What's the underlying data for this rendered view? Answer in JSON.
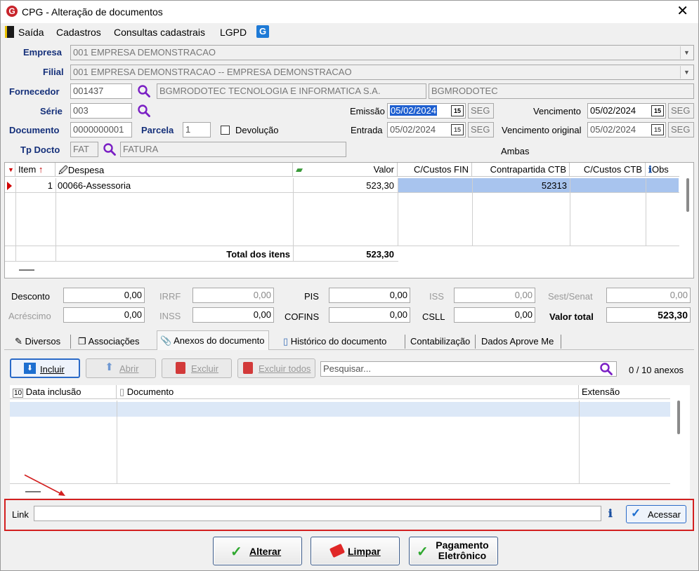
{
  "window": {
    "title": "CPG - Alteração de documentos"
  },
  "menu": {
    "items": [
      "Saída",
      "Cadastros",
      "Consultas cadastrais",
      "LGPD"
    ]
  },
  "form": {
    "empresa": {
      "label": "Empresa",
      "value": "001 EMPRESA DEMONSTRACAO"
    },
    "filial": {
      "label": "Filial",
      "value": "001 EMPRESA DEMONSTRACAO -- EMPRESA DEMONSTRACAO"
    },
    "fornecedor": {
      "label": "Fornecedor",
      "code": "001437",
      "name": "BGMRODOTEC TECNOLOGIA E INFORMATICA S.A.",
      "short": "BGMRODOTEC"
    },
    "serie": {
      "label": "Série",
      "value": "003"
    },
    "documento": {
      "label": "Documento",
      "value": "0000000001"
    },
    "parcela": {
      "label": "Parcela",
      "value": "1"
    },
    "devolucao": {
      "label": "Devolução",
      "checked": false
    },
    "tp_docto": {
      "label": "Tp Docto",
      "code": "FAT",
      "name": "FATURA"
    },
    "emissao": {
      "label": "Emissão",
      "date": "05/02/2024",
      "day": "SEG"
    },
    "entrada": {
      "label": "Entrada",
      "date": "05/02/2024",
      "day": "SEG"
    },
    "vencimento": {
      "label": "Vencimento",
      "date": "05/02/2024",
      "day": "SEG"
    },
    "vencimento_original": {
      "label": "Vencimento original",
      "date": "05/02/2024",
      "day": "SEG"
    },
    "ambas": "Ambas",
    "cal_glyph": "15"
  },
  "items_grid": {
    "columns": [
      "Item",
      "Despesa",
      "Valor",
      "C/Custos FIN",
      "Contrapartida CTB",
      "C/Custos CTB",
      "Obs"
    ],
    "rows": [
      {
        "item": "1",
        "despesa": "00066-Assessoria",
        "valor": "523,30",
        "cc_fin": "",
        "contrapartida": "52313",
        "cc_ctb": ""
      }
    ],
    "total_label": "Total dos itens",
    "total_value": "523,30"
  },
  "totals": {
    "desconto": {
      "label": "Desconto",
      "value": "0,00"
    },
    "irrf": {
      "label": "IRRF",
      "value": "0,00"
    },
    "pis": {
      "label": "PIS",
      "value": "0,00"
    },
    "iss": {
      "label": "ISS",
      "value": "0,00"
    },
    "sest": {
      "label": "Sest/Senat",
      "value": "0,00"
    },
    "acrescimo": {
      "label": "Acréscimo",
      "value": "0,00"
    },
    "inss": {
      "label": "INSS",
      "value": "0,00"
    },
    "cofins": {
      "label": "COFINS",
      "value": "0,00"
    },
    "csll": {
      "label": "CSLL",
      "value": "0,00"
    },
    "valor_total": {
      "label": "Valor total",
      "value": "523,30"
    }
  },
  "tabs": [
    "Diversos",
    "Associações",
    "Anexos do documento",
    "Histórico do documento",
    "Contabilização",
    "Dados Aprove Me"
  ],
  "attachments": {
    "buttons": {
      "incluir": "Incluir",
      "abrir": "Abrir",
      "excluir": "Excluir",
      "excluir_todos": "Excluir todos"
    },
    "search_placeholder": "Pesquisar...",
    "count": "0 / 10 anexos",
    "columns": [
      "Data inclusão",
      "Documento",
      "Extensão"
    ]
  },
  "link": {
    "label": "Link",
    "value": "",
    "acessar": "Acessar"
  },
  "footer": {
    "alterar": "Alterar",
    "limpar": "Limpar",
    "pagamento_1": "Pagamento",
    "pagamento_2": "Eletrônico"
  },
  "colors": {
    "label_blue": "#15307a",
    "selection": "#a8c4ee",
    "highlight_red": "#d32020",
    "accent_purple": "#7a1fc4"
  }
}
